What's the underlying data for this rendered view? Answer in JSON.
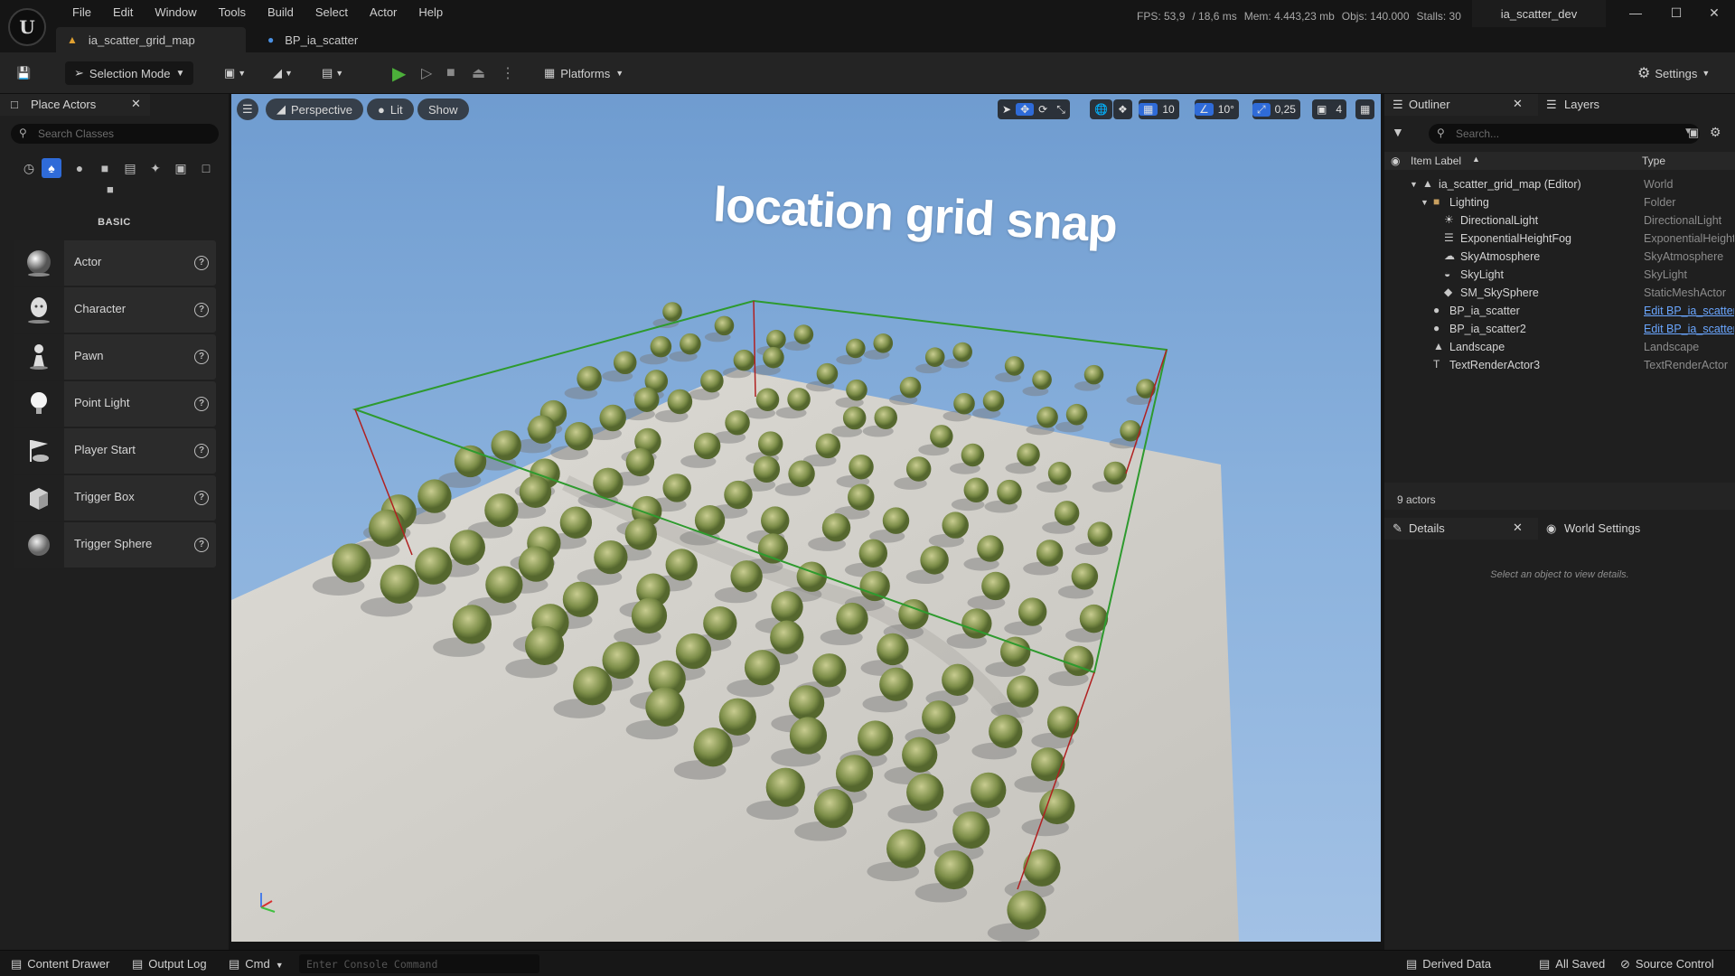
{
  "menu": [
    "File",
    "Edit",
    "Window",
    "Tools",
    "Build",
    "Select",
    "Actor",
    "Help"
  ],
  "stats": {
    "fps": "FPS: 53,9",
    "ms": "/ 18,6 ms",
    "mem": "Mem: 4.443,23 mb",
    "objs": "Objs: 140.000",
    "stalls": "Stalls: 30"
  },
  "project_name": "ia_scatter_dev",
  "tabs": [
    "ia_scatter_grid_map",
    "BP_ia_scatter"
  ],
  "toolbar": {
    "selection_mode": "Selection Mode",
    "platforms": "Platforms",
    "settings": "Settings"
  },
  "place_actors": {
    "title": "Place Actors",
    "search_placeholder": "Search Classes",
    "section": "BASIC",
    "items": [
      "Actor",
      "Character",
      "Pawn",
      "Point Light",
      "Player Start",
      "Trigger Box",
      "Trigger Sphere"
    ]
  },
  "viewport": {
    "perspective": "Perspective",
    "lit": "Lit",
    "show": "Show",
    "grid_snap": "10",
    "rotation_snap": "10°",
    "scale_snap": "0,25",
    "camera_speed": "4",
    "overlay_text": "location grid snap"
  },
  "outliner": {
    "title": "Outliner",
    "layers_tab": "Layers",
    "search_placeholder": "Search...",
    "col_label": "Item Label",
    "col_type": "Type",
    "rows": [
      {
        "name": "ia_scatter_grid_map (Editor)",
        "type": "World",
        "icon": "world-icon",
        "level": 0
      },
      {
        "name": "Lighting",
        "type": "Folder",
        "icon": "folder-icon",
        "level": 1
      },
      {
        "name": "DirectionalLight",
        "type": "DirectionalLight",
        "icon": "directional-light-icon",
        "level": 2
      },
      {
        "name": "ExponentialHeightFog",
        "type": "ExponentialHeightFog",
        "icon": "fog-icon",
        "level": 2
      },
      {
        "name": "SkyAtmosphere",
        "type": "SkyAtmosphere",
        "icon": "sky-atmosphere-icon",
        "level": 2
      },
      {
        "name": "SkyLight",
        "type": "SkyLight",
        "icon": "skylight-icon",
        "level": 2
      },
      {
        "name": "SM_SkySphere",
        "type": "StaticMeshActor",
        "icon": "static-mesh-icon",
        "level": 2
      },
      {
        "name": "BP_ia_scatter",
        "type": "Edit BP_ia_scatter",
        "icon": "blueprint-icon",
        "level": 1
      },
      {
        "name": "BP_ia_scatter2",
        "type": "Edit BP_ia_scatter",
        "icon": "blueprint-icon",
        "level": 1
      },
      {
        "name": "Landscape",
        "type": "Landscape",
        "icon": "landscape-icon",
        "level": 1
      },
      {
        "name": "TextRenderActor3",
        "type": "TextRenderActor",
        "icon": "text-render-icon",
        "level": 1
      }
    ],
    "count": "9 actors"
  },
  "details": {
    "title": "Details",
    "world_settings": "World Settings",
    "empty_message": "Select an object to view details."
  },
  "statusbar": {
    "content_drawer": "Content Drawer",
    "output_log": "Output Log",
    "cmd": "Cmd",
    "console_placeholder": "Enter Console Command",
    "derived_data": "Derived Data",
    "all_saved": "All Saved",
    "source_control": "Source Control"
  }
}
